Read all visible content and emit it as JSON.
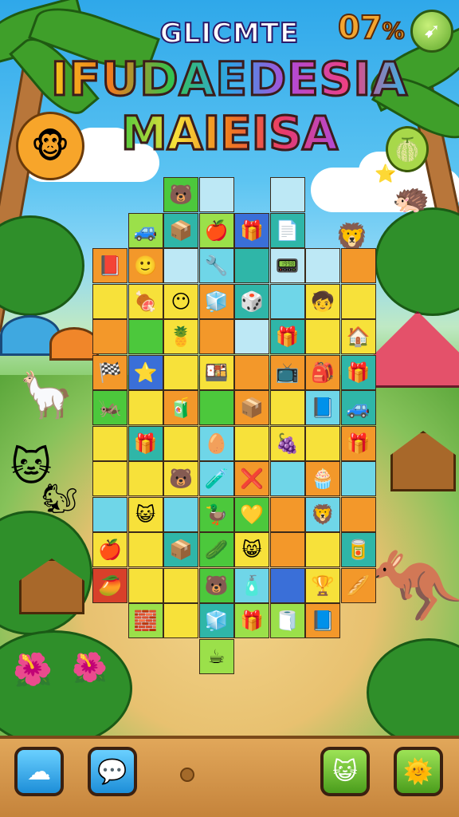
{
  "header": {
    "title_small": "GLICMTE",
    "title_line1": "IFUDAEDESIA",
    "title_line2": "MAIEISA",
    "score": "07",
    "score_suffix": "%",
    "menu_icon": "leaf-arrow-icon"
  },
  "colors": {
    "yellow": "#f7e13a",
    "orange": "#f3982a",
    "green": "#4cc83c",
    "lime": "#9be04a",
    "cyan": "#6fd6e8",
    "teal": "#2fb6a8",
    "blue": "#3a6fd8",
    "red": "#d8402a",
    "empty": "#bde8f5"
  },
  "board": {
    "cols": [
      0,
      1,
      2,
      3,
      4,
      5,
      6,
      7
    ],
    "rows": [
      [
        "",
        "",
        "green:🐻",
        "empty:",
        "",
        "empty:",
        "",
        ""
      ],
      [
        "",
        "lime:🚙",
        "teal:📦",
        "lime:🍎",
        "blue:🎁",
        "teal:📄",
        "",
        ""
      ],
      [
        "orange:📕",
        "orange:🙂",
        "empty:",
        "cyan:🔧",
        "teal:",
        "empty:📟",
        "empty:",
        "orange:"
      ],
      [
        "yellow:",
        "yellow:🍖",
        "yellow:😶",
        "orange:🧊",
        "teal:🎲",
        "cyan:",
        "yellow:🧒",
        "yellow:"
      ],
      [
        "orange:",
        "green:",
        "yellow:🍍",
        "orange:",
        "empty:",
        "teal:🎁",
        "yellow:",
        "yellow:🏠"
      ],
      [
        "orange:🏁",
        "blue:⭐",
        "yellow:",
        "yellow:🍱",
        "orange:",
        "orange:📺",
        "orange:🎒",
        "teal:🎁"
      ],
      [
        "green:🦗",
        "yellow:",
        "orange:🧃",
        "green:",
        "orange:📦",
        "yellow:",
        "cyan:📘",
        "teal:🚙"
      ],
      [
        "yellow:",
        "teal:🎁",
        "yellow:",
        "cyan:🥚",
        "yellow:",
        "yellow:🍇",
        "yellow:",
        "orange:🎁"
      ],
      [
        "yellow:",
        "yellow:",
        "yellow:🐻",
        "cyan:🧪",
        "orange:❌",
        "cyan:",
        "orange:🧁",
        "cyan:"
      ],
      [
        "cyan:",
        "yellow:😺",
        "cyan:",
        "green:🦆",
        "green:💛",
        "orange:",
        "cyan:🦁",
        "orange:"
      ],
      [
        "yellow:🍎",
        "yellow:",
        "teal:📦",
        "green:🥒",
        "yellow:😸",
        "orange:",
        "yellow:",
        "teal:🥫"
      ],
      [
        "red:🥭",
        "yellow:",
        "yellow:",
        "green:🐻",
        "cyan:🧴",
        "blue:",
        "yellow:🏆",
        "orange:🥖"
      ],
      [
        "",
        "lime:🧱",
        "yellow:",
        "teal:🧊",
        "lime:🎁",
        "lime:🧻",
        "orange:📘",
        ""
      ],
      [
        "",
        "",
        "",
        "lime:☕",
        "",
        "",
        "",
        ""
      ]
    ]
  },
  "bottom_bar": {
    "left1_icon": "cloud-chat-icon",
    "left2_icon": "speech-bubble-icon",
    "right1_icon": "cat-face-icon",
    "right2_icon": "sun-cat-icon",
    "left1_glyph": "☁",
    "left2_glyph": "💬",
    "right1_glyph": "😺",
    "right2_glyph": "🌞"
  },
  "decor": {
    "sun_glyph": "🐵",
    "fruit_glyph": "🍈",
    "star_glyph": "⭐",
    "hedgehog_glyph": "🦔",
    "lion_glyph": "🦁",
    "kangaroo_glyph": "🦘",
    "cat_glyph": "🐱",
    "camel_glyph": "🦙",
    "squirrel_glyph": "🐿",
    "flower_glyph": "🌺"
  }
}
